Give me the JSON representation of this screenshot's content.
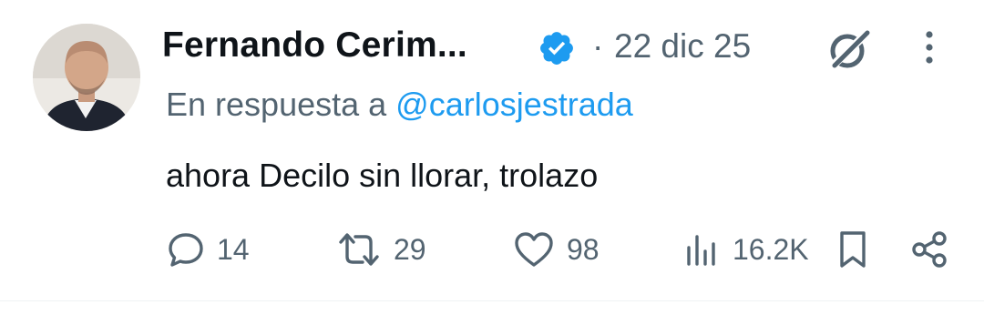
{
  "tweet": {
    "author": {
      "display_name": "Fernando Cerim...",
      "verified": true,
      "avatar_icon": "avatar-photo"
    },
    "separator": "·",
    "date": "22 dic 25",
    "header_icons": [
      "grok-icon",
      "more-options-icon"
    ],
    "reply_prefix": "En respuesta a",
    "reply_handle": "@carlosjestrada",
    "text": "ahora Decilo sin llorar, trolazo",
    "actions": {
      "replies": "14",
      "retweets": "29",
      "likes": "98",
      "views": "16.2K"
    }
  },
  "colors": {
    "text_primary": "#0f1419",
    "text_secondary": "#536471",
    "accent_blue": "#1d9bf0"
  }
}
